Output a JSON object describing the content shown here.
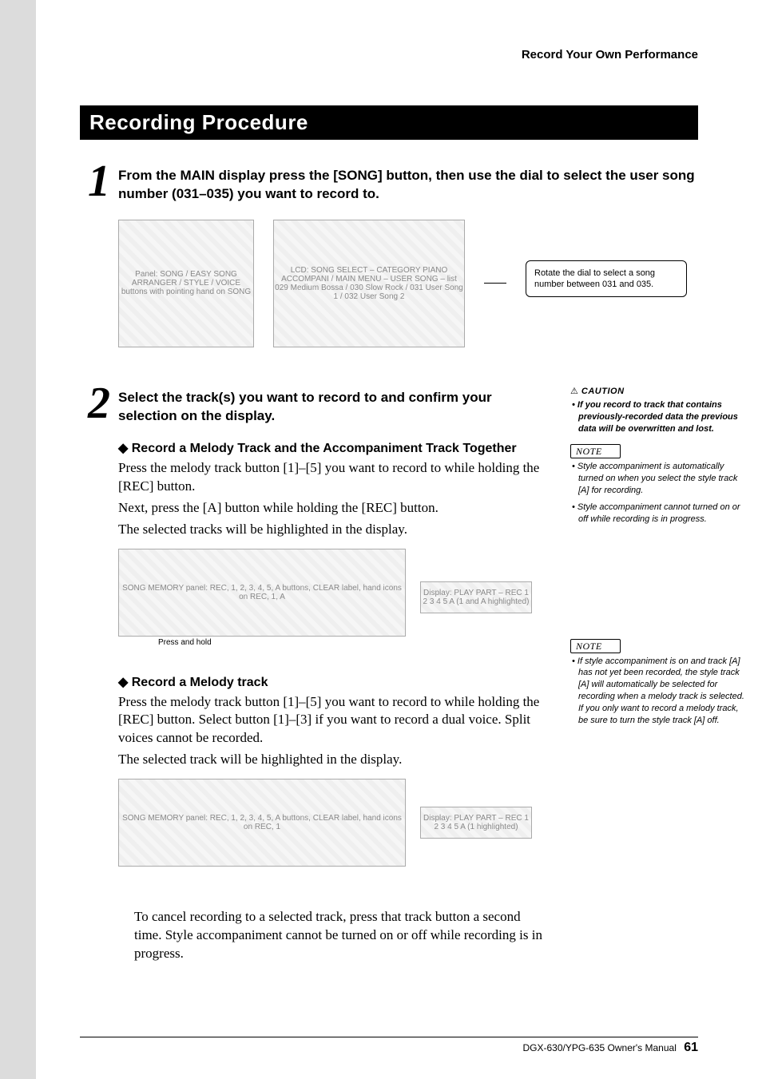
{
  "header": {
    "section_right": "Record Your Own Performance"
  },
  "title_bar": "Recording Procedure",
  "step1": {
    "number": "1",
    "heading": "From the MAIN display press the [SONG] button, then use the dial to select the user song number (031–035) you want to record to.",
    "fig_buttons_alt": "Panel: SONG / EASY SONG ARRANGER / STYLE / VOICE buttons with pointing hand on SONG",
    "fig_lcd_alt": "LCD: SONG SELECT – CATEGORY PIANO ACCOMPANI / MAIN MENU – USER SONG – list 029 Medium Bossa / 030 Slow Rock / 031 User Song 1 / 032 User Song 2",
    "callout": "Rotate the dial to select a song number between 031 and 035."
  },
  "step2": {
    "number": "2",
    "heading": "Select the track(s) you want to record to and confirm your selection on the display.",
    "subA": {
      "title": "Record a Melody Track and the Accompaniment Track Together",
      "p1": "Press the melody track button [1]–[5] you want to record to while holding the [REC] button.",
      "p2": "Next, press the [A] button while holding the [REC] button.",
      "p3": "The selected tracks will be highlighted in the display.",
      "fig_song_memory_alt": "SONG MEMORY panel: REC, 1, 2, 3, 4, 5, A buttons, CLEAR label, hand icons on REC, 1, A",
      "fig_play_part_alt": "Display: PLAY PART – REC 1 2 3 4 5 A (1 and A highlighted)",
      "press_hold": "Press and hold"
    },
    "caution": {
      "label": "CAUTION",
      "item": "If you record to track that contains previously-recorded data the previous data will be overwritten and lost."
    },
    "noteA": {
      "label": "NOTE",
      "items": [
        "Style accompaniment is automatically turned on when you select the style track [A] for recording.",
        "Style accompaniment cannot turned on or off while recording is in progress."
      ]
    },
    "subB": {
      "title": "Record a Melody track",
      "p1": "Press the melody track button [1]–[5] you want to record to while holding the [REC] button. Select button [1]–[3] if you want to record a dual voice. Split voices cannot be recorded.",
      "p2": "The selected track will be highlighted in the display.",
      "fig_song_memory_alt": "SONG MEMORY panel: REC, 1, 2, 3, 4, 5, A buttons, CLEAR label, hand icons on REC, 1",
      "fig_play_part_alt": "Display: PLAY PART – REC 1 2 3 4 5 A (1 highlighted)"
    },
    "noteB": {
      "label": "NOTE",
      "items": [
        "If style accompaniment is on and track [A] has not yet been recorded, the style track [A] will automatically be selected for recording when a melody track is selected. If you only want to record a melody track, be sure to turn the style track [A] off."
      ]
    },
    "cancel_para": "To cancel recording to a selected track, press that track button a second time. Style accompaniment cannot be turned on or off while recording is in progress."
  },
  "footer": {
    "manual": "DGX-630/YPG-635  Owner's Manual",
    "page": "61"
  }
}
